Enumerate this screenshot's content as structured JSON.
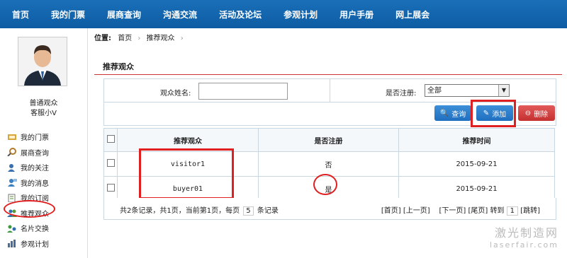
{
  "nav": [
    "首页",
    "我的门票",
    "展商查询",
    "沟通交流",
    "活动及论坛",
    "参观计划",
    "用户手册",
    "网上展会"
  ],
  "user": {
    "name": "普通观众",
    "sub": "客服小V"
  },
  "menu": [
    {
      "label": "我的门票",
      "icon": "ticket-icon",
      "color": "#c79a2a"
    },
    {
      "label": "展商查询",
      "icon": "search-icon",
      "color": "#b07a2a"
    },
    {
      "label": "我的关注",
      "icon": "user-follow-icon",
      "color": "#3a6fb0"
    },
    {
      "label": "我的消息",
      "icon": "message-icon",
      "color": "#3a7fc0"
    },
    {
      "label": "我的订阅",
      "icon": "subscription-icon",
      "color": "#5a8a3a"
    },
    {
      "label": "推荐观众",
      "icon": "recommend-users-icon",
      "color": "#2f6fb0"
    },
    {
      "label": "名片交换",
      "icon": "card-exchange-icon",
      "color": "#3a9a3a"
    },
    {
      "label": "参观计划",
      "icon": "plan-icon",
      "color": "#4a6a9a"
    }
  ],
  "breadcrumb": {
    "label": "位置:",
    "items": [
      "首页",
      "推荐观众"
    ]
  },
  "section_title": "推荐观众",
  "filter": {
    "name_label": "观众姓名:",
    "name_value": "",
    "register_label": "是否注册:",
    "register_value": "全部"
  },
  "buttons": {
    "query": "查询",
    "add": "添加",
    "delete": "删除"
  },
  "table": {
    "headers": [
      "推荐观众",
      "是否注册",
      "推荐时间"
    ],
    "rows": [
      {
        "name": "visitor1",
        "registered": "否",
        "time": "2015-09-21"
      },
      {
        "name": "buyer01",
        "registered": "是",
        "time": "2015-09-21"
      }
    ]
  },
  "pager": {
    "summary_a": "共2条记录，共1页，当前第1页，每页",
    "per_page": "5",
    "summary_b": "条记录",
    "first": "[首页]",
    "prev": "[上一页]",
    "next": "[下一页]",
    "last": "[尾页]",
    "goto": "转到",
    "page": "1",
    "jump": "[跳转]"
  },
  "watermark": {
    "cn": "激光制造网",
    "en": "laserfair.com"
  }
}
